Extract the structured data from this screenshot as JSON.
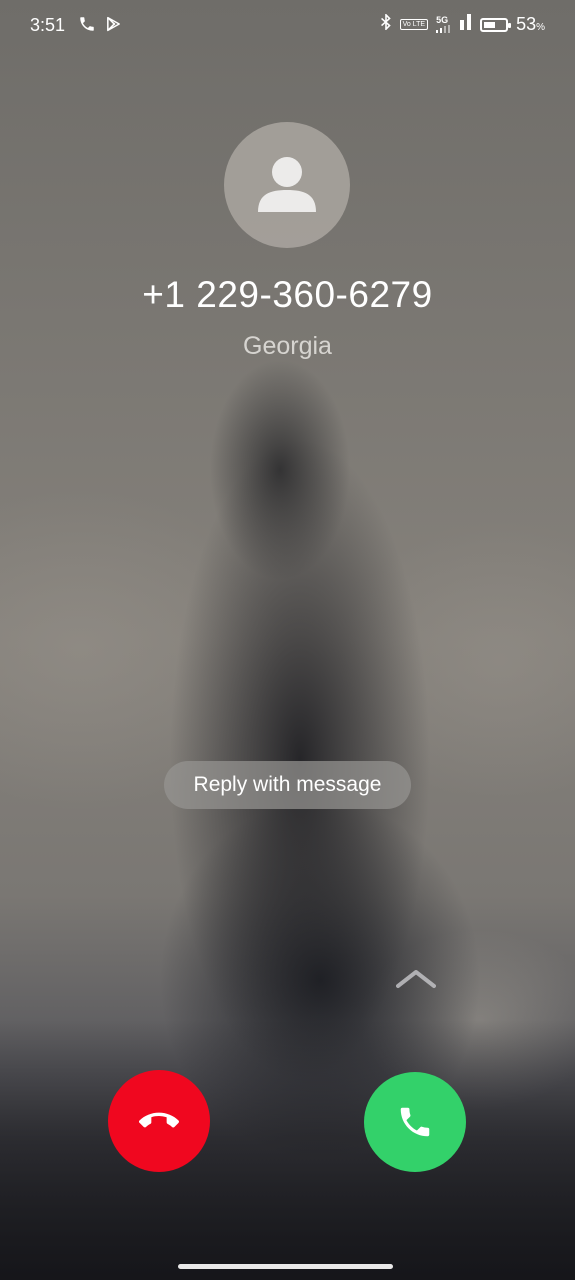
{
  "status_bar": {
    "time": "3:51",
    "left_icons": [
      "phone-icon",
      "play-store-icon"
    ],
    "right_icons": [
      "bluetooth-icon",
      "volte-icon",
      "5g-signal-icon",
      "signal-icon",
      "battery-icon"
    ],
    "volte_label": "Vo LTE",
    "network_label": "5G",
    "battery_level": 0.53,
    "battery_percent": "53",
    "battery_symbol": "%"
  },
  "caller": {
    "avatar_icon": "person-icon",
    "number": "+1 229-360-6279",
    "location": "Georgia"
  },
  "actions": {
    "reply_label": "Reply with message",
    "swipe_icon": "chevron-up-icon",
    "decline_icon": "hang-up-icon",
    "answer_icon": "phone-answer-icon"
  },
  "colors": {
    "decline": "#f0071f",
    "answer": "#33d16a"
  }
}
